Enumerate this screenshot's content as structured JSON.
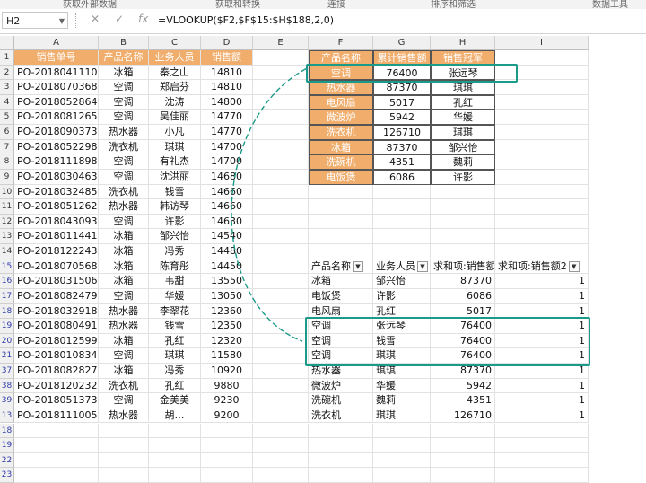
{
  "ribbon": {
    "items": [
      "获取外部数据",
      "获取和转换",
      "连接",
      "排序和筛选",
      "数据工具"
    ]
  },
  "formula_bar": {
    "name_box": "H2",
    "cancel_icon": "✕",
    "enter_icon": "✓",
    "fx_icon": "fx",
    "formula": "=VLOOKUP($F2,$F$15:$H$188,2,0)"
  },
  "columns": [
    "A",
    "B",
    "C",
    "D",
    "E",
    "F",
    "G",
    "H",
    "I"
  ],
  "row_numbers": [
    "1",
    "2",
    "3",
    "4",
    "5",
    "6",
    "7",
    "8",
    "9",
    "10",
    "11",
    "12",
    "13",
    "14",
    "15",
    "16",
    "17",
    "18",
    "19",
    "20",
    "21",
    "37",
    "38",
    "39",
    "13",
    "18",
    "19",
    "22",
    "23"
  ],
  "orders": {
    "headers": [
      "销售单号",
      "产品名称",
      "业务人员",
      "销售额"
    ],
    "rows": [
      [
        "PO-20180411106",
        "冰箱",
        "秦之山",
        "14810"
      ],
      [
        "PO-20180703688",
        "空调",
        "郑启芬",
        "14810"
      ],
      [
        "PO-20180528641",
        "空调",
        "沈涛",
        "14800"
      ],
      [
        "PO-20180812654",
        "空调",
        "吴佳丽",
        "14770"
      ],
      [
        "PO-20180903739",
        "热水器",
        "小凡",
        "14770"
      ],
      [
        "PO-20180522988",
        "洗衣机",
        "琪琪",
        "14700"
      ],
      [
        "PO-20181118983",
        "空调",
        "有礼杰",
        "14700"
      ],
      [
        "PO-20180304635",
        "空调",
        "沈洪丽",
        "14680"
      ],
      [
        "PO-20180324856",
        "洗衣机",
        "钱雪",
        "14660"
      ],
      [
        "PO-20180512624",
        "热水器",
        "韩访琴",
        "14660"
      ],
      [
        "PO-20180430935",
        "空调",
        "许影",
        "14630"
      ],
      [
        "PO-20180114413",
        "冰箱",
        "邹兴怡",
        "14540"
      ],
      [
        "PO-20181222435",
        "冰箱",
        "冯秀",
        "14480"
      ],
      [
        "PO-20180705686",
        "冰箱",
        "陈育彤",
        "14450"
      ],
      [
        "PO-20180315063",
        "冰箱",
        "韦甜",
        "13550"
      ],
      [
        "PO-20180824795",
        "空调",
        "华媛",
        "13050"
      ],
      [
        "PO-20180329186",
        "热水器",
        "李翠花",
        "12360"
      ],
      [
        "PO-20180804914",
        "热水器",
        "钱雪",
        "12350"
      ],
      [
        "PO-20180125996",
        "冰箱",
        "孔红",
        "12320"
      ],
      [
        "PO-20180108346",
        "空调",
        "琪琪",
        "11580"
      ],
      [
        "PO-20180828279",
        "冰箱",
        "冯秀",
        "10920"
      ],
      [
        "PO-20181202320",
        "洗衣机",
        "孔红",
        "9880"
      ],
      [
        "PO-20180513735",
        "空调",
        "金美美",
        "9230"
      ],
      [
        "PO-20181110056",
        "热水器",
        "胡…",
        "9200"
      ]
    ]
  },
  "summary": {
    "headers": [
      "产品名称",
      "累计销售额",
      "销售冠军"
    ],
    "rows": [
      [
        "空调",
        "76400",
        "张远琴"
      ],
      [
        "热水器",
        "87370",
        "琪琪"
      ],
      [
        "电风扇",
        "5017",
        "孔红"
      ],
      [
        "微波炉",
        "5942",
        "华媛"
      ],
      [
        "洗衣机",
        "126710",
        "琪琪"
      ],
      [
        "冰箱",
        "87370",
        "邹兴怡"
      ],
      [
        "洗碗机",
        "4351",
        "魏莉"
      ],
      [
        "电饭煲",
        "6086",
        "许影"
      ]
    ]
  },
  "pivot": {
    "headers": [
      "产品名称",
      "业务人员",
      "求和项:销售额",
      "求和项:销售额2"
    ],
    "rows": [
      [
        "冰箱",
        "邹兴怡",
        "87370",
        "1"
      ],
      [
        "电饭煲",
        "许影",
        "6086",
        "1"
      ],
      [
        "电风扇",
        "孔红",
        "5017",
        "1"
      ],
      [
        "空调",
        "张远琴",
        "76400",
        "1"
      ],
      [
        "空调",
        "钱雪",
        "76400",
        "1"
      ],
      [
        "空调",
        "琪琪",
        "76400",
        "1"
      ],
      [
        "热水器",
        "琪琪",
        "87370",
        "1"
      ],
      [
        "微波炉",
        "华媛",
        "5942",
        "1"
      ],
      [
        "洗碗机",
        "魏莉",
        "4351",
        "1"
      ],
      [
        "洗衣机",
        "琪琪",
        "126710",
        "1"
      ]
    ]
  },
  "colors": {
    "header_fill": "#f0ad6c",
    "highlight": "#1a9a88"
  }
}
